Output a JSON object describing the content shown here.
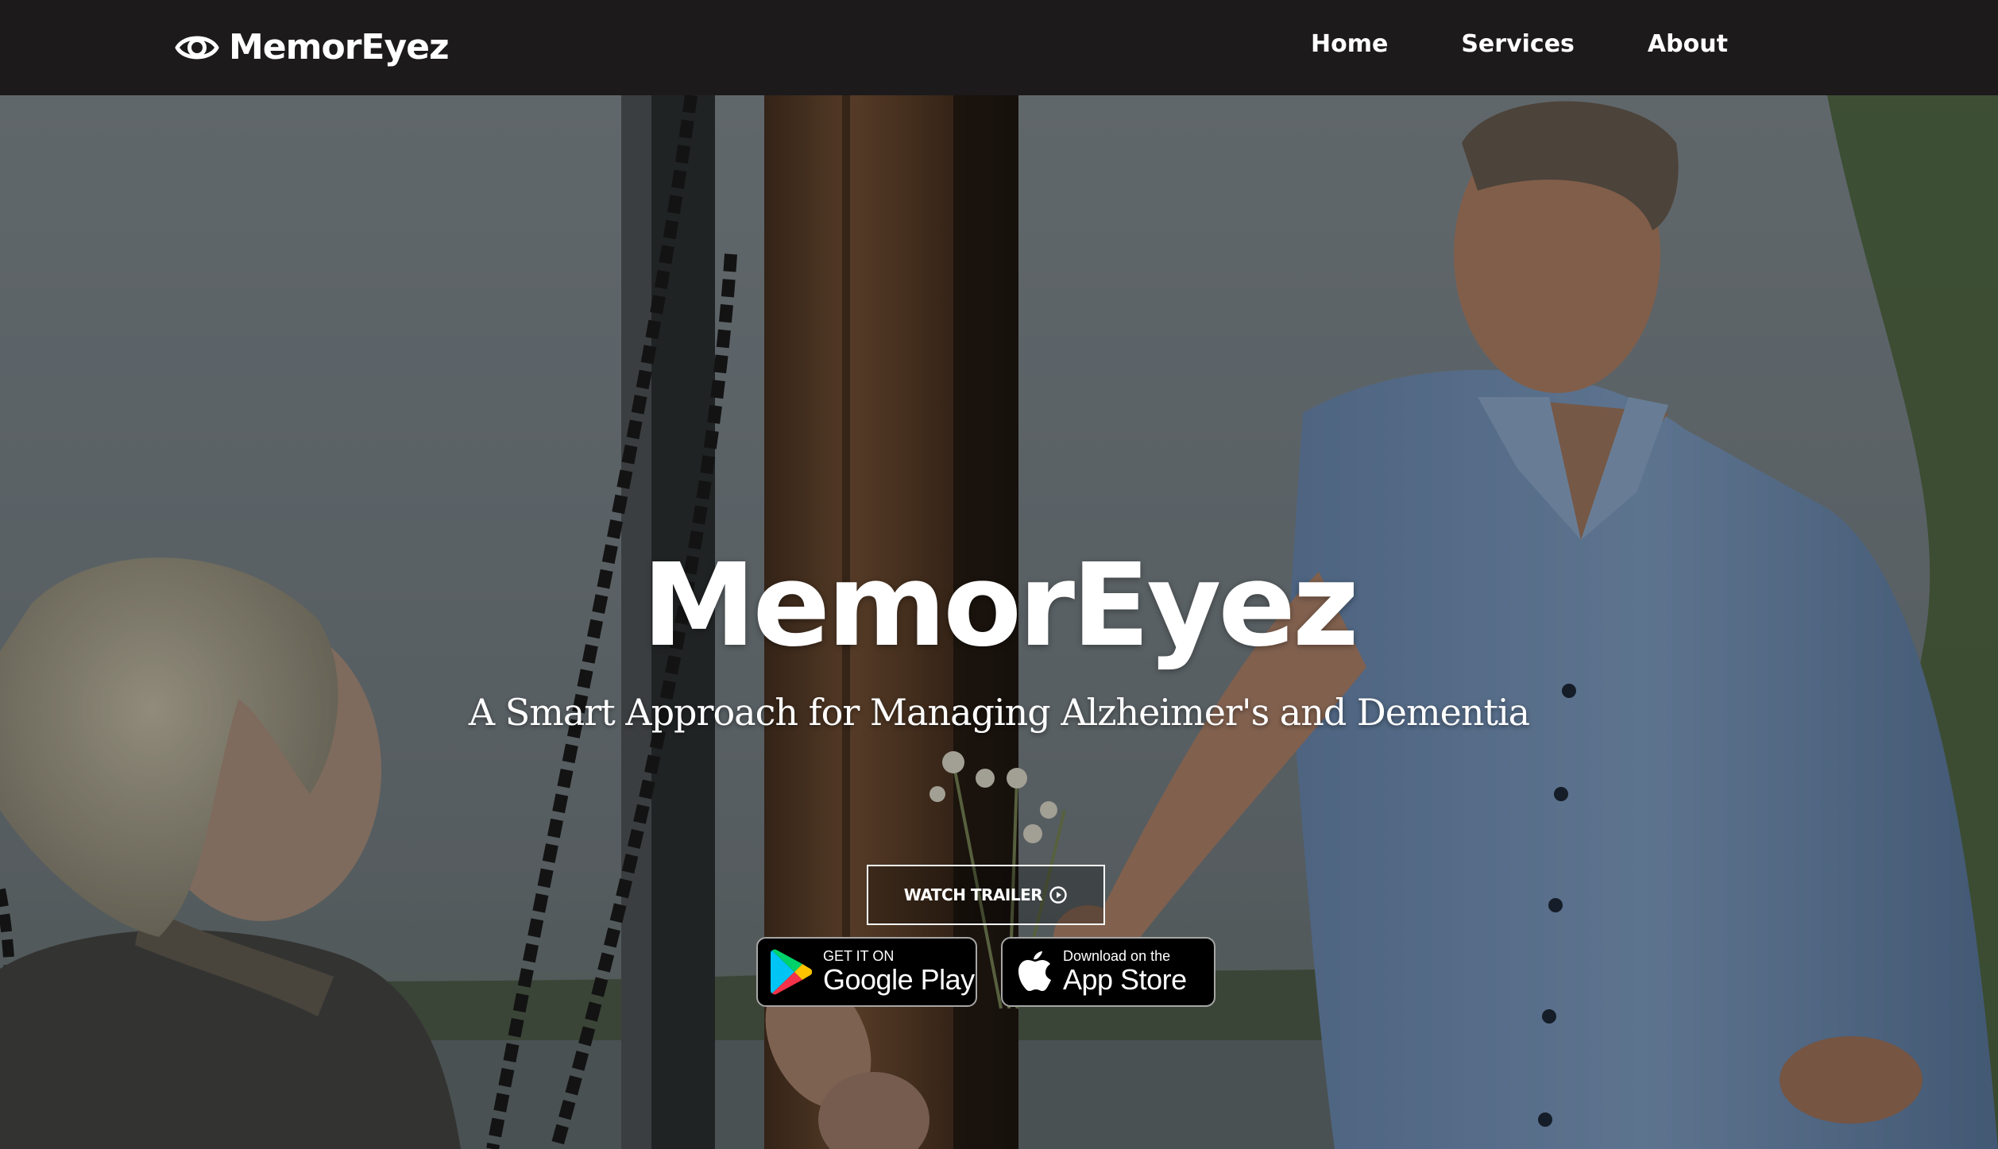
{
  "navbar": {
    "brand": {
      "name": "MemorEyez",
      "icon": "eye-icon"
    },
    "links": [
      {
        "label": "Home"
      },
      {
        "label": "Services"
      },
      {
        "label": "About"
      }
    ]
  },
  "hero": {
    "title": "MemorEyez",
    "subtitle": "A Smart Approach for Managing Alzheimer's and Dementia",
    "trailer_button": {
      "label": "WATCH TRAILER",
      "icon": "play-circle-icon"
    },
    "badges": {
      "google_play": {
        "small": "GET IT ON",
        "big": "Google Play",
        "icon": "google-play-icon"
      },
      "app_store": {
        "small": "Download on the",
        "big": "App Store",
        "icon": "apple-icon"
      }
    }
  },
  "colors": {
    "navbar_bg": "#1c1a1b",
    "text": "#ffffff",
    "sky": "#7f8a92",
    "shirt": "#7d9dc4",
    "wood": "#6b4a32"
  }
}
